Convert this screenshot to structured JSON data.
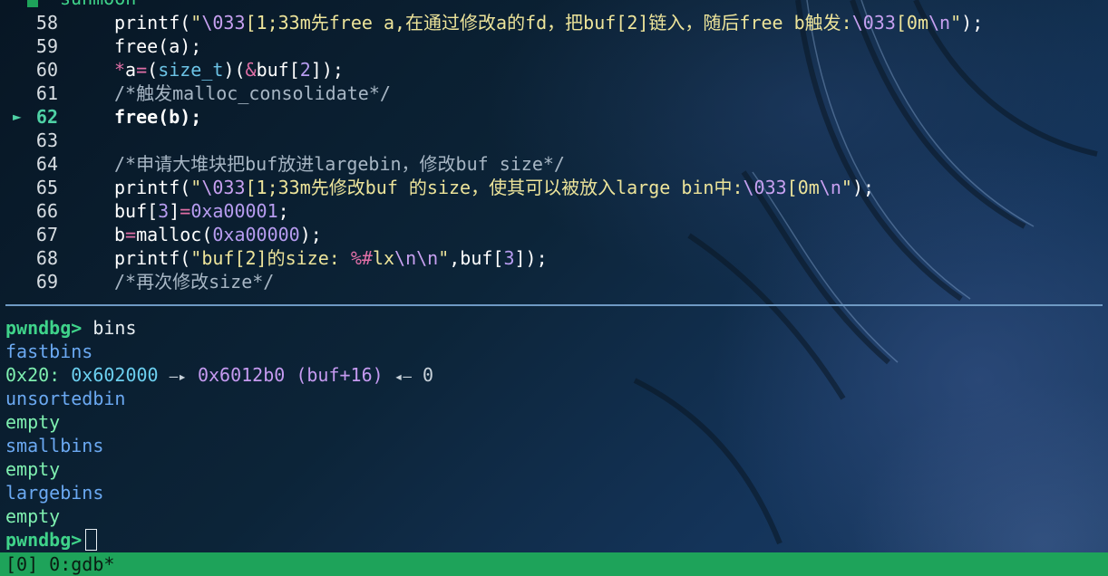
{
  "window": {
    "title_fragment": "sunmoon"
  },
  "source": {
    "lines": [
      {
        "num": "58",
        "parts": [
          [
            "kw",
            "printf("
          ],
          [
            "str",
            "\""
          ],
          [
            "esc",
            "\\033"
          ],
          [
            "str",
            "[1;33m先free a,在通过修改a的fd，把buf[2]链入，随后free b触发:"
          ],
          [
            "esc",
            "\\033"
          ],
          [
            "str",
            "[0m"
          ],
          [
            "esc",
            "\\n"
          ],
          [
            "str",
            "\""
          ],
          [
            "kw",
            ");"
          ]
        ]
      },
      {
        "num": "59",
        "parts": [
          [
            "kw",
            "free(a);"
          ]
        ]
      },
      {
        "num": "60",
        "parts": [
          [
            "op",
            "*"
          ],
          [
            "kw",
            "a"
          ],
          [
            "op",
            "="
          ],
          [
            "kw",
            "("
          ],
          [
            "type",
            "size_t"
          ],
          [
            "kw",
            ")("
          ],
          [
            "op",
            "&"
          ],
          [
            "kw",
            "buf["
          ],
          [
            "num",
            "2"
          ],
          [
            "kw",
            "]);"
          ]
        ]
      },
      {
        "num": "61",
        "parts": [
          [
            "cmt",
            "/*触发malloc_consolidate*/"
          ]
        ]
      },
      {
        "num": "62",
        "current": true,
        "parts": [
          [
            "kw bold",
            "free(b);"
          ]
        ]
      },
      {
        "num": "63",
        "parts": []
      },
      {
        "num": "64",
        "parts": [
          [
            "cmt",
            "/*申请大堆块把buf放进largebin，修改buf size*/"
          ]
        ]
      },
      {
        "num": "65",
        "parts": [
          [
            "kw",
            "printf("
          ],
          [
            "str",
            "\""
          ],
          [
            "esc",
            "\\033"
          ],
          [
            "str",
            "[1;33m先修改buf 的size，使其可以被放入large bin中:"
          ],
          [
            "esc",
            "\\033"
          ],
          [
            "str",
            "[0m"
          ],
          [
            "esc",
            "\\n"
          ],
          [
            "str",
            "\""
          ],
          [
            "kw",
            ");"
          ]
        ]
      },
      {
        "num": "66",
        "parts": [
          [
            "kw",
            "buf["
          ],
          [
            "num",
            "3"
          ],
          [
            "kw",
            "]"
          ],
          [
            "op",
            "="
          ],
          [
            "num",
            "0xa00001"
          ],
          [
            "kw",
            ";"
          ]
        ]
      },
      {
        "num": "67",
        "parts": [
          [
            "kw",
            "b"
          ],
          [
            "op",
            "="
          ],
          [
            "kw",
            "malloc("
          ],
          [
            "num",
            "0xa00000"
          ],
          [
            "kw",
            ");"
          ]
        ]
      },
      {
        "num": "68",
        "parts": [
          [
            "kw",
            "printf("
          ],
          [
            "str",
            "\"buf[2]的size: "
          ],
          [
            "op",
            "%#"
          ],
          [
            "str",
            "lx"
          ],
          [
            "esc",
            "\\n\\n"
          ],
          [
            "str",
            "\""
          ],
          [
            "kw",
            ",buf["
          ],
          [
            "num",
            "3"
          ],
          [
            "kw",
            "]);"
          ]
        ]
      },
      {
        "num": "69",
        "parts": [
          [
            "cmt",
            "/*再次修改size*/"
          ]
        ]
      }
    ],
    "current_marker": "►"
  },
  "terminal": {
    "prompt": "pwndbg>",
    "command": "bins",
    "fastbins_label": "fastbins",
    "fastbin_entry": {
      "size": "0x20:",
      "addr1": "0x602000",
      "arrow1": "—▸",
      "addr2": "0x6012b0",
      "sym": "(buf+16)",
      "arrow2": "◂—",
      "tail": "0"
    },
    "unsortedbin_label": "unsortedbin",
    "unsortedbin_value": "empty",
    "smallbins_label": "smallbins",
    "smallbins_value": "empty",
    "largebins_label": "largebins",
    "largebins_value": "empty",
    "final_prompt": "pwndbg>"
  },
  "statusbar": {
    "text": "[0] 0:gdb*"
  },
  "colors": {
    "prompt": "#3fd38a",
    "status_bg": "#1ea35a",
    "divider": "#6f9ac4"
  }
}
